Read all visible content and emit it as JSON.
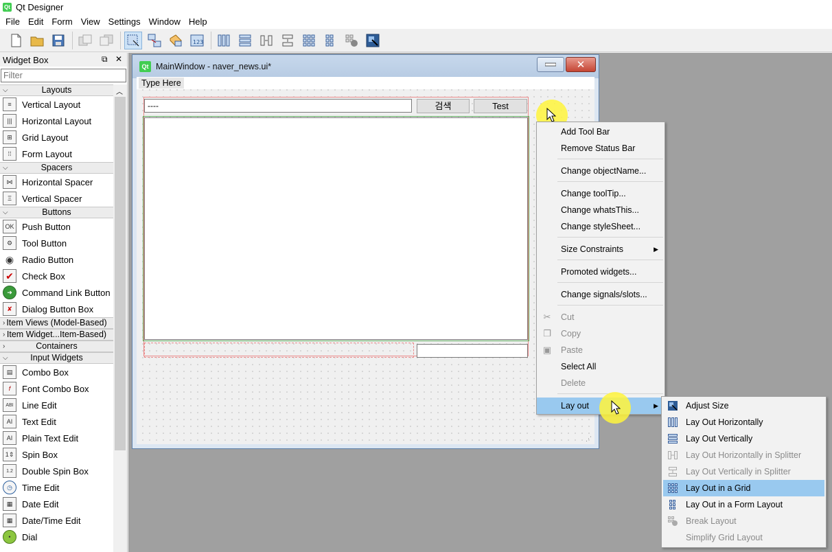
{
  "app": {
    "title": "Qt Designer"
  },
  "menubar": [
    "File",
    "Edit",
    "Form",
    "View",
    "Settings",
    "Window",
    "Help"
  ],
  "widget_box": {
    "title": "Widget Box",
    "filter_placeholder": "Filter",
    "categories": {
      "layouts": "Layouts",
      "spacers": "Spacers",
      "buttons": "Buttons",
      "item_views": "Item Views (Model-Based)",
      "item_widgets": "Item Widget...Item-Based)",
      "containers": "Containers",
      "input_widgets": "Input Widgets"
    },
    "layouts": [
      "Vertical Layout",
      "Horizontal Layout",
      "Grid Layout",
      "Form Layout"
    ],
    "spacers": [
      "Horizontal Spacer",
      "Vertical Spacer"
    ],
    "buttons": [
      "Push Button",
      "Tool Button",
      "Radio Button",
      "Check Box",
      "Command Link Button",
      "Dialog Button Box"
    ],
    "input_widgets": [
      "Combo Box",
      "Font Combo Box",
      "Line Edit",
      "Text Edit",
      "Plain Text Edit",
      "Spin Box",
      "Double Spin Box",
      "Time Edit",
      "Date Edit",
      "Date/Time Edit",
      "Dial"
    ]
  },
  "form_window": {
    "title": "MainWindow - naver_news.ui*",
    "type_here": "Type Here",
    "line_edit_value": "----",
    "search_button": "검색",
    "test_button": "Test"
  },
  "context_menu": {
    "items": [
      "Add Tool Bar",
      "Remove Status Bar",
      "Change objectName...",
      "Change toolTip...",
      "Change whatsThis...",
      "Change styleSheet...",
      "Size Constraints",
      "Promoted widgets...",
      "Change signals/slots...",
      "Cut",
      "Copy",
      "Paste",
      "Select All",
      "Delete",
      "Lay out"
    ]
  },
  "layout_submenu": {
    "items": [
      "Adjust Size",
      "Lay Out Horizontally",
      "Lay Out Vertically",
      "Lay Out Horizontally in Splitter",
      "Lay Out Vertically in Splitter",
      "Lay Out in a Grid",
      "Lay Out in a Form Layout",
      "Break Layout",
      "Simplify Grid Layout"
    ],
    "highlighted": "Lay Out in a Grid"
  },
  "colors": {
    "highlight": "#99c9ef",
    "qt_green": "#41cd52",
    "mdi_background": "#a0a0a0"
  }
}
